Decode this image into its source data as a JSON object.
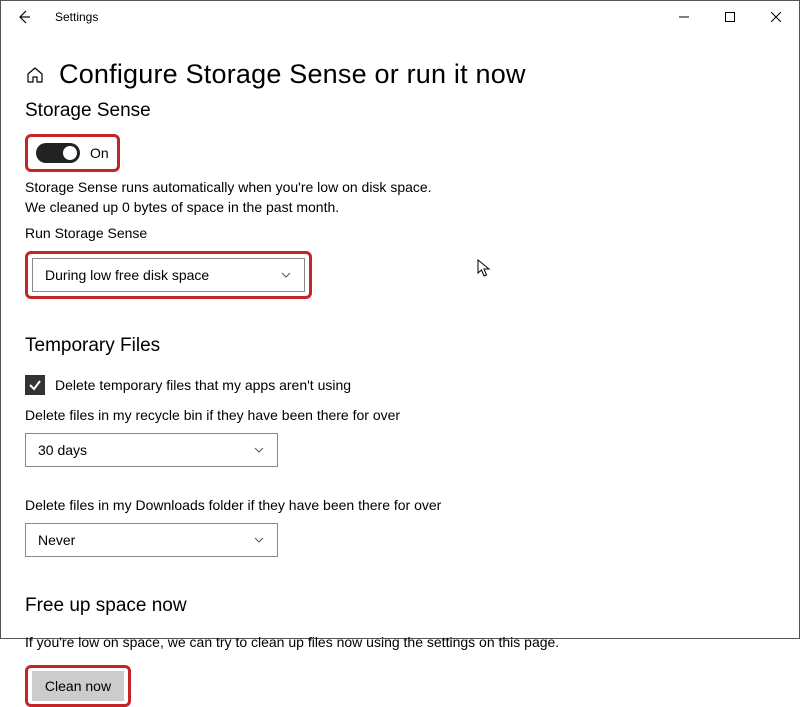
{
  "titlebar": {
    "title": "Settings"
  },
  "page": {
    "heading": "Configure Storage Sense or run it now"
  },
  "storageSense": {
    "heading": "Storage Sense",
    "toggle": {
      "state": "On"
    },
    "description": "Storage Sense runs automatically when you're low on disk space. We cleaned up 0 bytes of space in the past month.",
    "runLabel": "Run Storage Sense",
    "runValue": "During low free disk space"
  },
  "tempFiles": {
    "heading": "Temporary Files",
    "checkboxLabel": "Delete temporary files that my apps aren't using",
    "recycleLabel": "Delete files in my recycle bin if they have been there for over",
    "recycleValue": "30 days",
    "downloadsLabel": "Delete files in my Downloads folder if they have been there for over",
    "downloadsValue": "Never"
  },
  "freeUp": {
    "heading": "Free up space now",
    "description": "If you're low on space, we can try to clean up files now using the settings on this page.",
    "buttonLabel": "Clean now"
  }
}
